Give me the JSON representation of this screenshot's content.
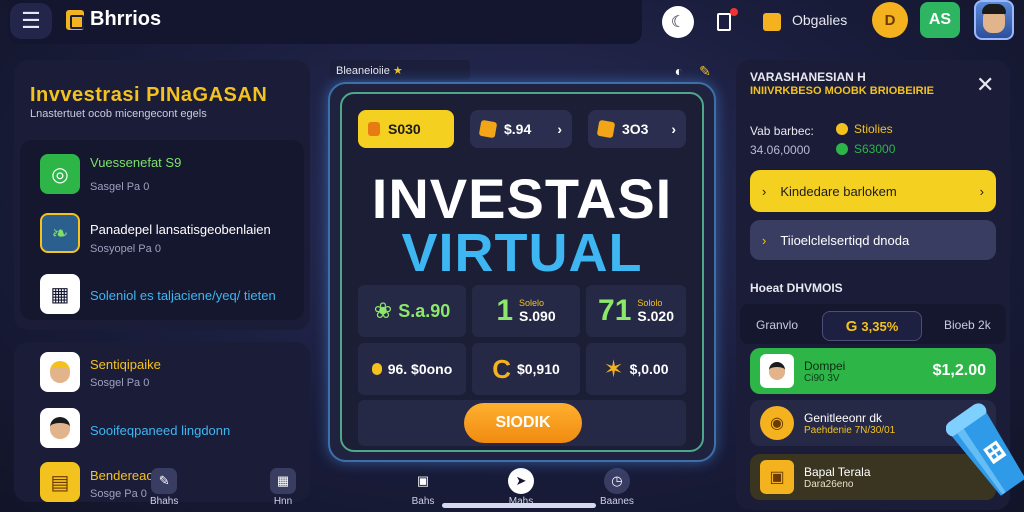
{
  "topbar": {
    "menu_icon": "hamburger-icon",
    "brand": "Bhrrios",
    "label_objects": "Obgalies",
    "coin_label": "D",
    "as_label": "AS"
  },
  "left_panel": {
    "title": "Invvestrasi PINaGASAN",
    "subtitle": "Lnastertuet ocob micengecont egels",
    "items": [
      {
        "title": "Vuessenefat S9",
        "sub": "Sasgel Pa 0",
        "title_color": "#7ee06a",
        "icon": "target-icon",
        "icon_bg": "#2db548"
      },
      {
        "title": "Panadepel lansatisgeobenlaien",
        "sub": "Sosyopel Pa 0",
        "title_color": "#ffffff",
        "icon": "bird-icon",
        "icon_bg": "#2a5f8e"
      },
      {
        "title": "Soleniol es taljaciene/yeq/ tieten",
        "sub": "",
        "title_color": "#3eb6f2",
        "icon": "basket-icon",
        "icon_bg": "#ffffff"
      }
    ]
  },
  "left_panel2": {
    "items": [
      {
        "title": "Sentiqipaike",
        "sub": "Sosgel Pa 0",
        "title_color": "#f4c21f"
      },
      {
        "title": "Sooifeqpaneed lingdonn",
        "sub": "",
        "title_color": "#3eb6f2"
      },
      {
        "title": "Bendereaon",
        "sub": "Sosge Pa 0",
        "title_color": "#f4c21f"
      }
    ]
  },
  "bottom_nav": [
    {
      "label": "Bhahs",
      "icon": "pencil-icon"
    },
    {
      "label": "Hnn",
      "icon": "grid-icon"
    },
    {
      "label": "Bahs",
      "icon": "bag-icon"
    },
    {
      "label": "Mahs",
      "icon": "compass-icon"
    },
    {
      "label": "Baanes",
      "icon": "clock-icon"
    }
  ],
  "center": {
    "header": "Bleaneioiie",
    "pills": [
      {
        "label": "S030"
      },
      {
        "label": "$.94"
      },
      {
        "label": "3O3"
      }
    ],
    "headline_line1": "INVESTASI",
    "headline_line2": "VIRTUAL",
    "stats": [
      {
        "big": "",
        "small": "S.a.90",
        "tiny": "",
        "icon": "leaf-icon",
        "small_color": "#8be86a"
      },
      {
        "big": "1",
        "small": "S.090",
        "tiny": "Solelo",
        "icon": "",
        "small_color": "#ffffff"
      },
      {
        "big": "71",
        "small": "S.020",
        "tiny": "Sololo",
        "icon": "",
        "small_color": "#ffffff"
      },
      {
        "big": "",
        "small": "96. $0ono",
        "tiny": "",
        "icon": "coin-icon",
        "small_color": "#ffffff"
      },
      {
        "big": "",
        "small": "$0,910",
        "tiny": "",
        "icon": "c-coin-icon",
        "small_color": "#ffffff"
      },
      {
        "big": "",
        "small": "$,0.00",
        "tiny": "",
        "icon": "star-icon",
        "small_color": "#ffffff"
      }
    ],
    "cta_label": "SIODIK"
  },
  "right_panel": {
    "title": "VARASHANESIAN H",
    "subtitle": "INIIVRKBESO MOOBK BRIOBEIRIE",
    "balance_label": "Vab barbec:",
    "balance_value": "34.06,0000",
    "tag1": "Stiolies",
    "tag2": "S63000",
    "btn_primary": "Kindedare barlokem",
    "btn_secondary": "Tiioelclelsertiqd dnoda",
    "section_title": "Hoeat DHVMOIS",
    "seg_left": "Granvlo",
    "seg_active": "3,35%",
    "seg_right": "Bioeb 2k",
    "rows": [
      {
        "title": "Dompei",
        "sub": "Ci90 3V",
        "amount": "$1,2.00"
      },
      {
        "title": "Genitleeonr dk",
        "sub": "Paehdenie 7N/30/01",
        "amount": ""
      },
      {
        "title": "Bapal Terala",
        "sub": "Dara26eno",
        "amount": ""
      }
    ]
  },
  "colors": {
    "accent_yellow": "#f4d020",
    "accent_blue": "#3eb6f2",
    "accent_green": "#2db548",
    "panel_bg": "#1b1d38"
  }
}
